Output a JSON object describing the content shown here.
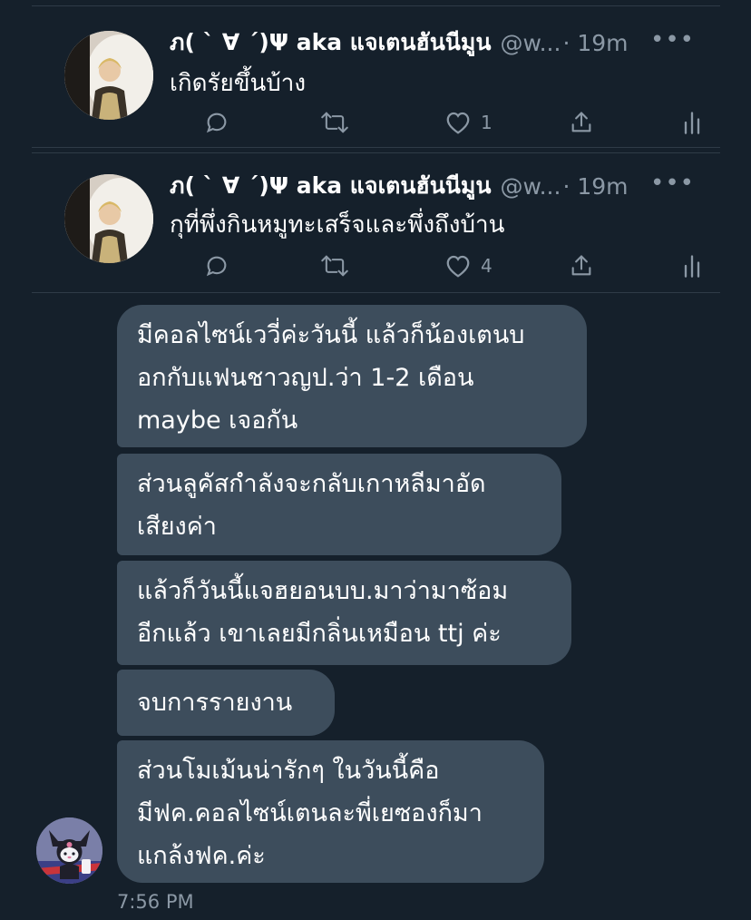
{
  "tweets": [
    {
      "display_name": "ภ( ` ∀ ´)Ψ aka แจเตนฮันนีมูน",
      "handle": "@w...",
      "time": "· 19m",
      "text": "เกิดรัยขึ้นบ้าง",
      "like_count": "1"
    },
    {
      "display_name": "ภ( ` ∀ ´)Ψ aka แจเตนฮันนีมูน",
      "handle": "@w...",
      "time": "· 19m",
      "text": "กุที่พึ่งกินหมูทะเสร็จและพึ่งถึงบ้าน",
      "like_count": "4"
    }
  ],
  "more_label": "•••",
  "messages": [
    {
      "lines": [
        "มีคอลไซน์เววี่ค่ะวันนี้ แล้วก็น้องเตนบ",
        "อกกับแฟนชาวญป.ว่า 1-2 เดือน",
        "maybe เจอกัน"
      ]
    },
    {
      "lines": [
        "ส่วนลูคัสกำลังจะกลับเกาหลีมาอัด",
        "เสียงค่า"
      ]
    },
    {
      "lines": [
        "แล้วก็วันนี้แจฮยอนบบ.มาว่ามาซ้อม",
        "อีกแล้ว เขาเลยมีกลิ่นเหมือน ttj ค่ะ"
      ]
    },
    {
      "lines": [
        "จบการรายงาน"
      ]
    },
    {
      "lines": [
        "ส่วนโมเม้นน่ารักๆ ในวันนี้คือ",
        "มีฟค.คอลไซน์เตนละพี่เยซองก็มา",
        "แกล้งฟค.ค่ะ"
      ]
    }
  ],
  "timestamp": "7:56 PM",
  "colors": {
    "background": "#15202b",
    "bubble": "#3d4d5c",
    "muted_text": "#8b98a5"
  },
  "icons": [
    "reply-icon",
    "retweet-icon",
    "like-icon",
    "share-icon",
    "analytics-icon",
    "more-icon"
  ]
}
